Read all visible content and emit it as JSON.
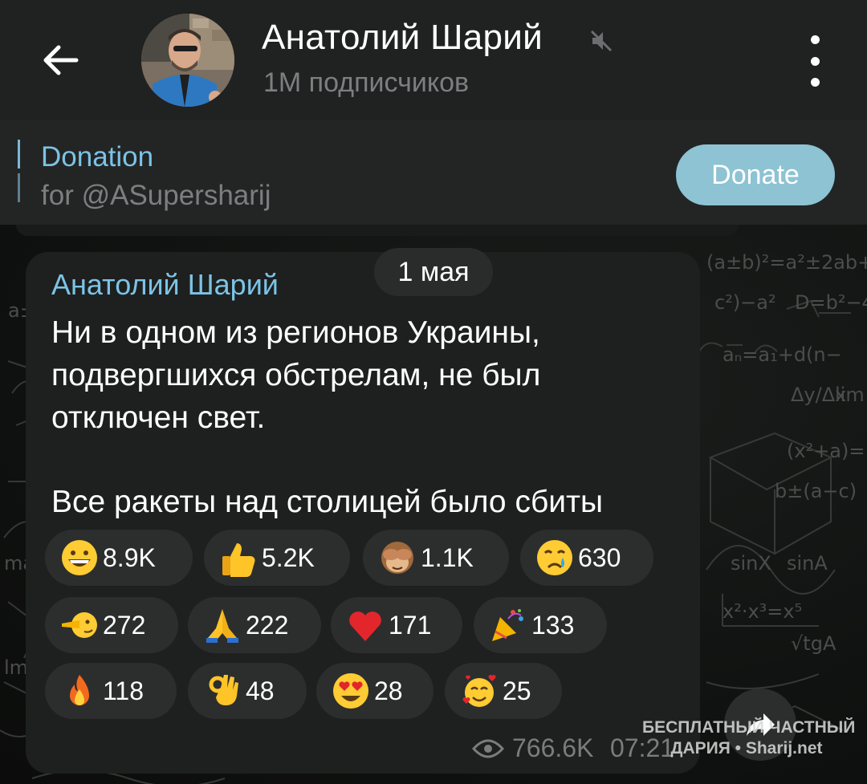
{
  "header": {
    "title": "Анатолий Шарий",
    "subtitle": "1M подписчиков",
    "back_icon": "arrow-left-icon",
    "mute_icon": "muted-speaker-icon",
    "menu_icon": "more-vertical-icon"
  },
  "pinned": {
    "title": "Donation",
    "subtitle": "for @ASupersharij",
    "button_label": "Donate"
  },
  "message": {
    "sender": "Анатолий Шарий",
    "date_label": "1 мая",
    "lines": [
      "Ни в одном из регионов Украины,",
      "подвергшихся обстрелам, не был",
      "отключен свет.",
      "",
      "Все ракеты над столицей было сбиты"
    ],
    "reactions": [
      {
        "emoji": "grinning-face",
        "count": "8.9K"
      },
      {
        "emoji": "thumbs-up",
        "count": "5.2K"
      },
      {
        "emoji": "see-no-evil-monkey",
        "count": "1.1K"
      },
      {
        "emoji": "crying-face",
        "count": "630"
      },
      {
        "emoji": "clown-pointing",
        "count": "272"
      },
      {
        "emoji": "folded-hands",
        "count": "222"
      },
      {
        "emoji": "red-heart",
        "count": "171"
      },
      {
        "emoji": "party-popper",
        "count": "133"
      },
      {
        "emoji": "fire",
        "count": "118"
      },
      {
        "emoji": "ok-hand",
        "count": "48"
      },
      {
        "emoji": "heart-eyes",
        "count": "28"
      },
      {
        "emoji": "smiling-face-with-hearts",
        "count": "25"
      }
    ],
    "views": "766.6K",
    "time": "07:21"
  },
  "watermark": {
    "line1": "БЕСПЛАТНЫЙ ЧАСТНЫЙ",
    "line2": "ДАРИЯ • Sharij.net"
  },
  "colors": {
    "accent": "#7cc3e6",
    "donate_button": "#8dc3d3",
    "bubble": "#1e1f1f",
    "header": "#202121"
  }
}
